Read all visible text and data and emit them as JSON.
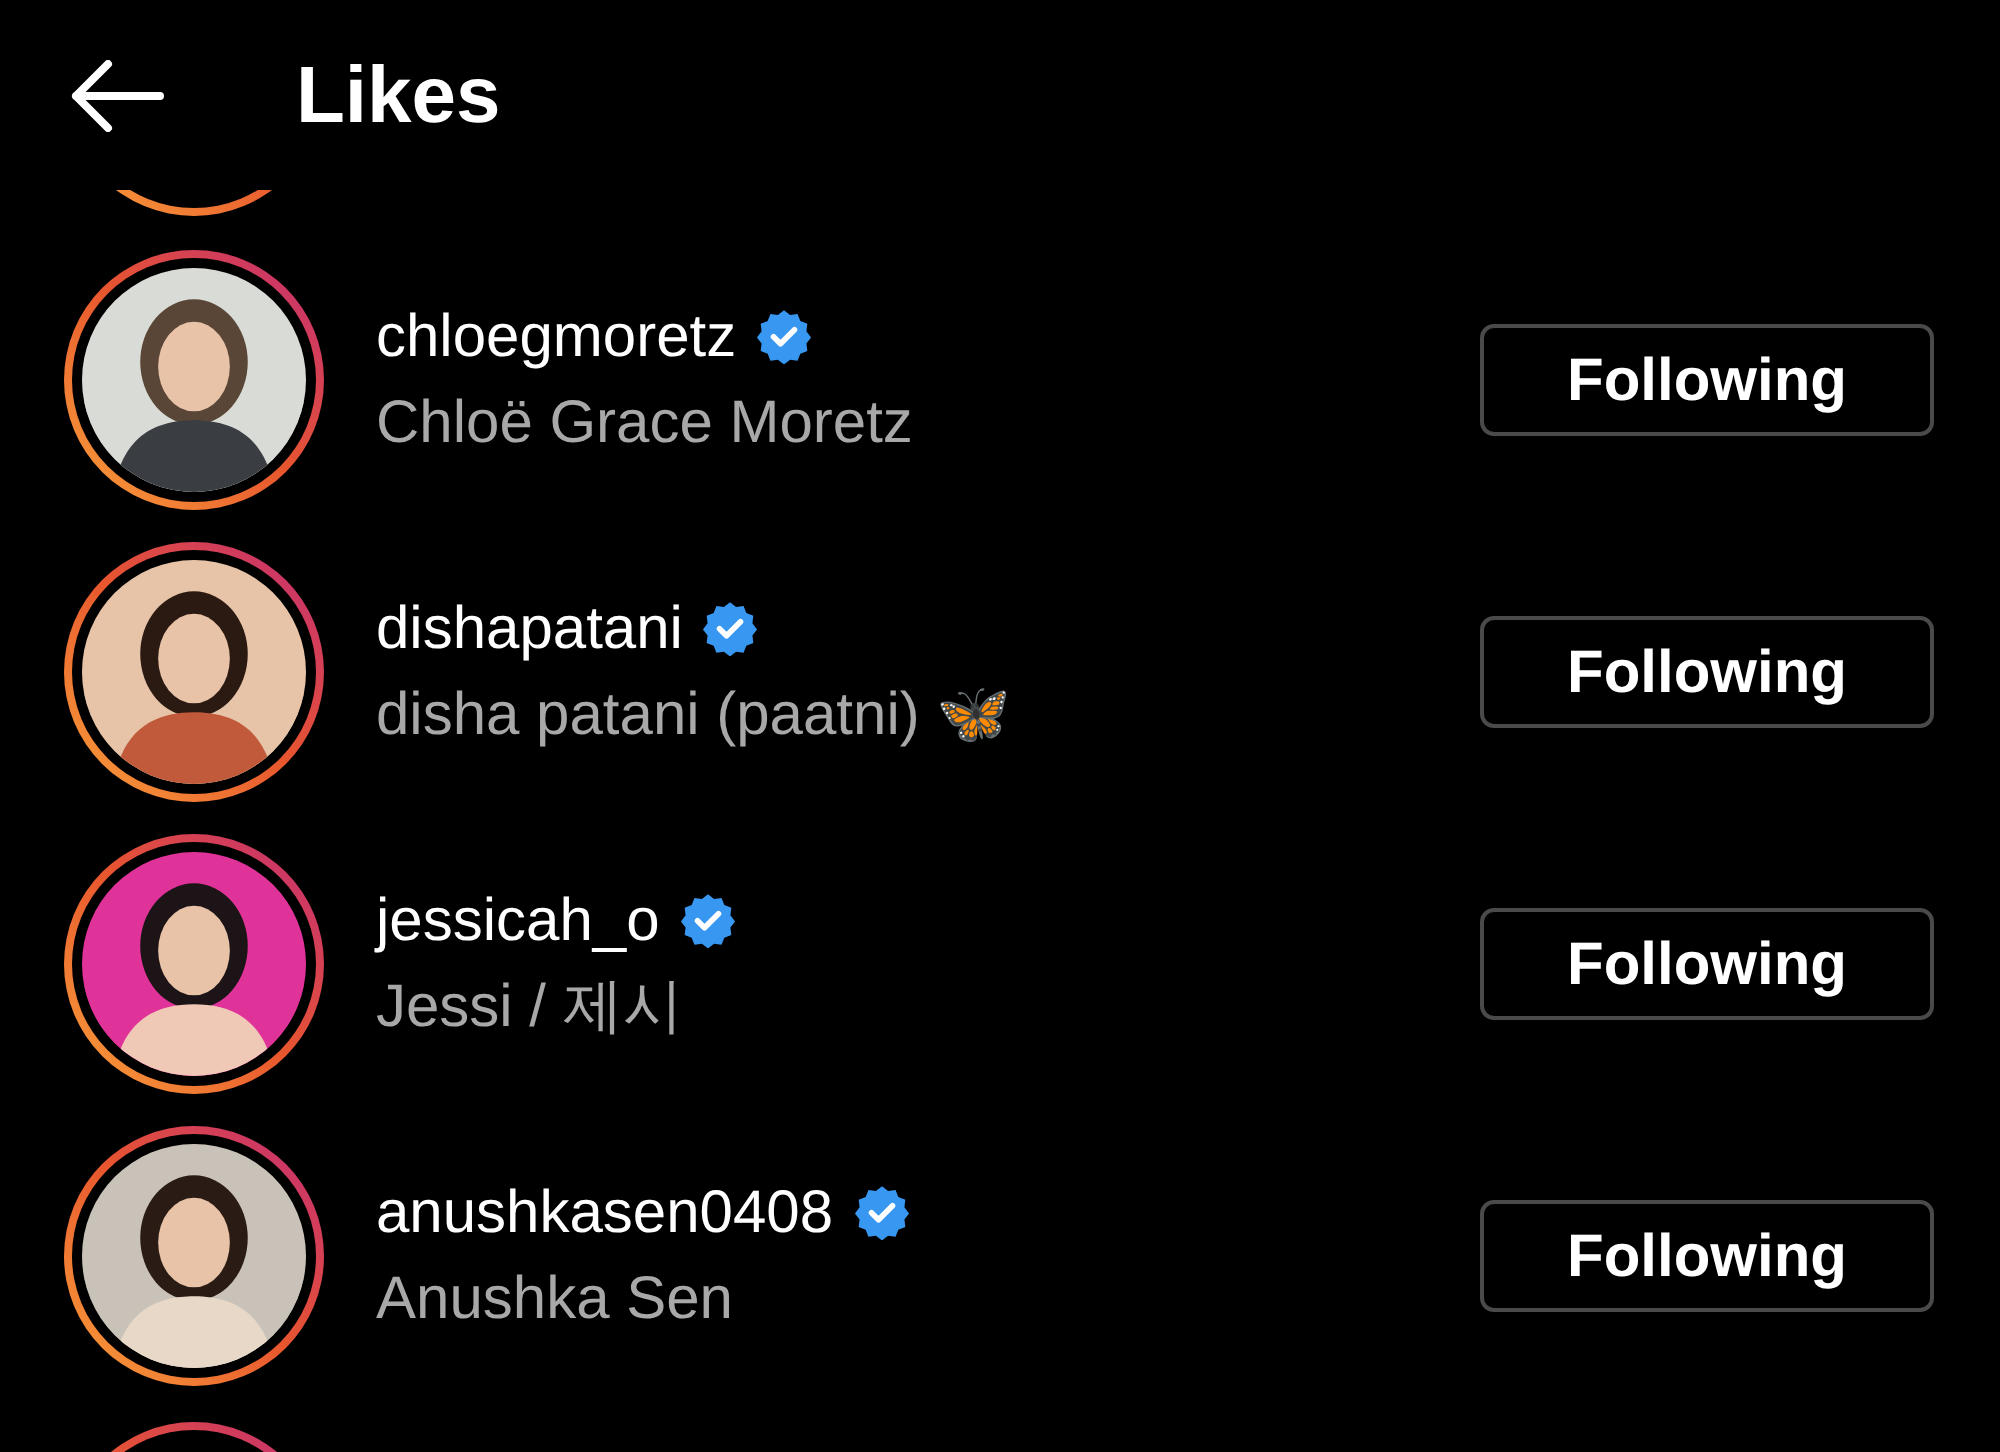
{
  "header": {
    "title": "Likes"
  },
  "rows": [
    {
      "username": "chloegmoretz",
      "verified": true,
      "full_name": "Chloë Grace Moretz",
      "button": "Following"
    },
    {
      "username": "dishapatani",
      "verified": true,
      "full_name": "disha patani (paatni) 🦋",
      "button": "Following"
    },
    {
      "username": "jessicah_o",
      "verified": true,
      "full_name": "Jessi / 제시",
      "button": "Following"
    },
    {
      "username": "anushkasen0408",
      "verified": true,
      "full_name": "Anushka Sen",
      "button": "Following"
    }
  ]
}
